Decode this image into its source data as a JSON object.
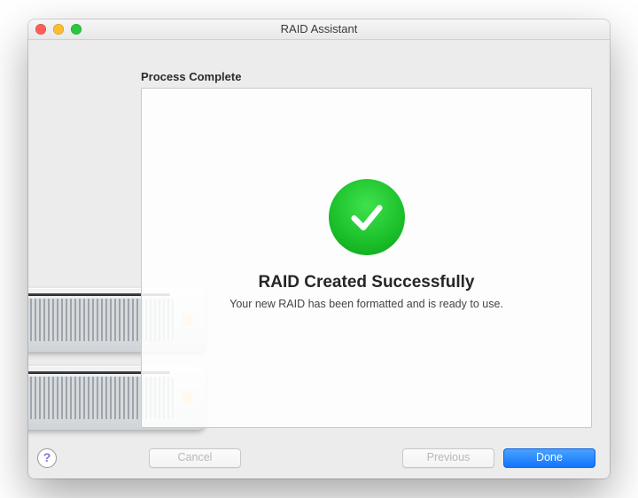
{
  "window": {
    "title": "RAID Assistant"
  },
  "heading": "Process Complete",
  "result": {
    "title": "RAID Created Successfully",
    "subtitle": "Your new RAID has been formatted and is ready to use."
  },
  "help": {
    "label": "?"
  },
  "buttons": {
    "cancel": "Cancel",
    "previous": "Previous",
    "done": "Done"
  },
  "colors": {
    "accent_blue": "#1274ff",
    "success_green": "#1bbf2a"
  }
}
